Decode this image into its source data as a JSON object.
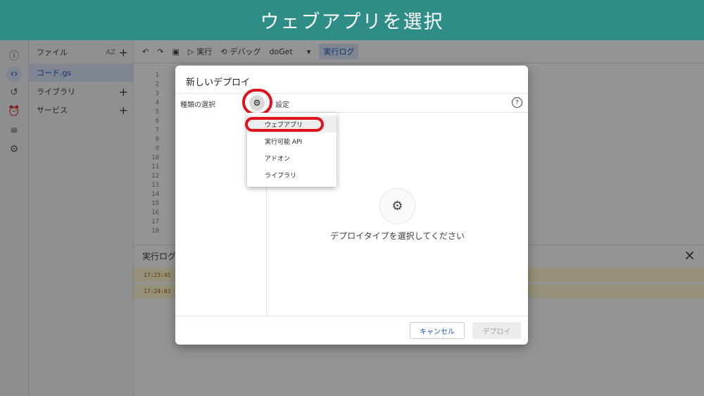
{
  "banner": {
    "title": "ウェブアプリを選択"
  },
  "rail": {
    "icons": [
      "info-icon",
      "code-icon",
      "history-icon",
      "alarm-icon",
      "list-run-icon",
      "settings-icon"
    ]
  },
  "files": {
    "header": "ファイル",
    "sort_label": "AZ",
    "file_name": "コード.gs",
    "libraries": "ライブラリ",
    "services": "サービス"
  },
  "toolbar": {
    "run": "実行",
    "debug": "デバッグ",
    "function": "doGet",
    "log": "実行ログ"
  },
  "gutter": [
    "1",
    "2",
    "3",
    "4",
    "5",
    "6",
    "7",
    "8",
    "9",
    "10",
    "11",
    "12",
    "13",
    "14",
    "15",
    "16",
    "17",
    "18"
  ],
  "log": {
    "title": "実行ログ",
    "rows": [
      "17:23:45",
      "17:24:03"
    ]
  },
  "dialog": {
    "title": "新しいデプロイ",
    "type_label": "種類の選択",
    "settings_label": "設定",
    "empty_text": "デプロイタイプを選択してください",
    "cancel": "キャンセル",
    "deploy": "デプロイ"
  },
  "menu": {
    "items": [
      "ウェブアプリ",
      "実行可能 API",
      "アドオン",
      "ライブラリ"
    ]
  },
  "colors": {
    "banner": "#2f8d88",
    "highlight_ring": "#e0121d",
    "accent": "#1a56c4"
  }
}
